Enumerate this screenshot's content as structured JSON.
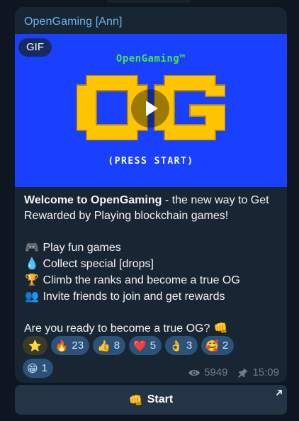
{
  "message": {
    "sender": "OpenGaming [Ann]",
    "media": {
      "badge": "GIF",
      "wordmark": "OpenGaming™",
      "tagline": "(PRESS START)",
      "background_color": "#1a40ff",
      "logo_color": "#ffc400"
    },
    "text": {
      "intro_bold": "Welcome to OpenGaming",
      "intro_rest": " - the new way to Get Rewarded by Playing blockchain games!",
      "items": [
        {
          "icon": "game-controller",
          "emoji": "🎮",
          "text": "Play fun games"
        },
        {
          "icon": "droplet",
          "emoji": "💧",
          "text": "Collect special [drops]"
        },
        {
          "icon": "trophy",
          "emoji": "🏆",
          "text": "Climb the ranks and become a true OG"
        },
        {
          "icon": "people",
          "emoji": "👥",
          "text": "Invite friends to join and get rewards"
        }
      ],
      "closing": "Are you ready to become a true OG? ",
      "closing_emoji": "👊"
    },
    "reactions": [
      {
        "icon": "star",
        "emoji": "⭐",
        "count": ""
      },
      {
        "icon": "fire",
        "emoji": "🔥",
        "count": "23"
      },
      {
        "icon": "thumbs-up",
        "emoji": "👍",
        "count": "8"
      },
      {
        "icon": "red-heart",
        "emoji": "❤️",
        "count": "5"
      },
      {
        "icon": "ok-hand",
        "emoji": "👌",
        "count": "3"
      },
      {
        "icon": "smiling-face-with-hearts",
        "emoji": "🥰",
        "count": "2"
      },
      {
        "icon": "grinning-face",
        "emoji": "😁",
        "count": "1"
      }
    ],
    "views": "5949",
    "time": "15:09",
    "pinned": true
  },
  "button": {
    "emoji": "👊",
    "label": "Start"
  },
  "colors": {
    "background": "#0e1621",
    "bubble": "#182533",
    "sender": "#6ab3f3",
    "reaction_bg": "#2b5278",
    "meta": "#6d7f8f"
  }
}
